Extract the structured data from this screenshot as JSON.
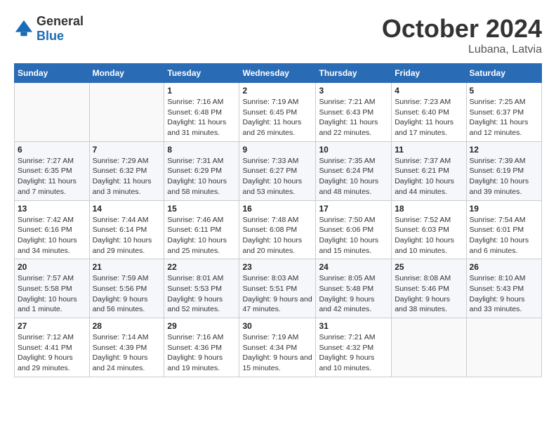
{
  "header": {
    "logo": {
      "general": "General",
      "blue": "Blue"
    },
    "title": "October 2024",
    "location": "Lubana, Latvia"
  },
  "calendar": {
    "days_of_week": [
      "Sunday",
      "Monday",
      "Tuesday",
      "Wednesday",
      "Thursday",
      "Friday",
      "Saturday"
    ],
    "weeks": [
      [
        {
          "day": "",
          "info": ""
        },
        {
          "day": "",
          "info": ""
        },
        {
          "day": "1",
          "info": "Sunrise: 7:16 AM\nSunset: 6:48 PM\nDaylight: 11 hours and 31 minutes."
        },
        {
          "day": "2",
          "info": "Sunrise: 7:19 AM\nSunset: 6:45 PM\nDaylight: 11 hours and 26 minutes."
        },
        {
          "day": "3",
          "info": "Sunrise: 7:21 AM\nSunset: 6:43 PM\nDaylight: 11 hours and 22 minutes."
        },
        {
          "day": "4",
          "info": "Sunrise: 7:23 AM\nSunset: 6:40 PM\nDaylight: 11 hours and 17 minutes."
        },
        {
          "day": "5",
          "info": "Sunrise: 7:25 AM\nSunset: 6:37 PM\nDaylight: 11 hours and 12 minutes."
        }
      ],
      [
        {
          "day": "6",
          "info": "Sunrise: 7:27 AM\nSunset: 6:35 PM\nDaylight: 11 hours and 7 minutes."
        },
        {
          "day": "7",
          "info": "Sunrise: 7:29 AM\nSunset: 6:32 PM\nDaylight: 11 hours and 3 minutes."
        },
        {
          "day": "8",
          "info": "Sunrise: 7:31 AM\nSunset: 6:29 PM\nDaylight: 10 hours and 58 minutes."
        },
        {
          "day": "9",
          "info": "Sunrise: 7:33 AM\nSunset: 6:27 PM\nDaylight: 10 hours and 53 minutes."
        },
        {
          "day": "10",
          "info": "Sunrise: 7:35 AM\nSunset: 6:24 PM\nDaylight: 10 hours and 48 minutes."
        },
        {
          "day": "11",
          "info": "Sunrise: 7:37 AM\nSunset: 6:21 PM\nDaylight: 10 hours and 44 minutes."
        },
        {
          "day": "12",
          "info": "Sunrise: 7:39 AM\nSunset: 6:19 PM\nDaylight: 10 hours and 39 minutes."
        }
      ],
      [
        {
          "day": "13",
          "info": "Sunrise: 7:42 AM\nSunset: 6:16 PM\nDaylight: 10 hours and 34 minutes."
        },
        {
          "day": "14",
          "info": "Sunrise: 7:44 AM\nSunset: 6:14 PM\nDaylight: 10 hours and 29 minutes."
        },
        {
          "day": "15",
          "info": "Sunrise: 7:46 AM\nSunset: 6:11 PM\nDaylight: 10 hours and 25 minutes."
        },
        {
          "day": "16",
          "info": "Sunrise: 7:48 AM\nSunset: 6:08 PM\nDaylight: 10 hours and 20 minutes."
        },
        {
          "day": "17",
          "info": "Sunrise: 7:50 AM\nSunset: 6:06 PM\nDaylight: 10 hours and 15 minutes."
        },
        {
          "day": "18",
          "info": "Sunrise: 7:52 AM\nSunset: 6:03 PM\nDaylight: 10 hours and 10 minutes."
        },
        {
          "day": "19",
          "info": "Sunrise: 7:54 AM\nSunset: 6:01 PM\nDaylight: 10 hours and 6 minutes."
        }
      ],
      [
        {
          "day": "20",
          "info": "Sunrise: 7:57 AM\nSunset: 5:58 PM\nDaylight: 10 hours and 1 minute."
        },
        {
          "day": "21",
          "info": "Sunrise: 7:59 AM\nSunset: 5:56 PM\nDaylight: 9 hours and 56 minutes."
        },
        {
          "day": "22",
          "info": "Sunrise: 8:01 AM\nSunset: 5:53 PM\nDaylight: 9 hours and 52 minutes."
        },
        {
          "day": "23",
          "info": "Sunrise: 8:03 AM\nSunset: 5:51 PM\nDaylight: 9 hours and 47 minutes."
        },
        {
          "day": "24",
          "info": "Sunrise: 8:05 AM\nSunset: 5:48 PM\nDaylight: 9 hours and 42 minutes."
        },
        {
          "day": "25",
          "info": "Sunrise: 8:08 AM\nSunset: 5:46 PM\nDaylight: 9 hours and 38 minutes."
        },
        {
          "day": "26",
          "info": "Sunrise: 8:10 AM\nSunset: 5:43 PM\nDaylight: 9 hours and 33 minutes."
        }
      ],
      [
        {
          "day": "27",
          "info": "Sunrise: 7:12 AM\nSunset: 4:41 PM\nDaylight: 9 hours and 29 minutes."
        },
        {
          "day": "28",
          "info": "Sunrise: 7:14 AM\nSunset: 4:39 PM\nDaylight: 9 hours and 24 minutes."
        },
        {
          "day": "29",
          "info": "Sunrise: 7:16 AM\nSunset: 4:36 PM\nDaylight: 9 hours and 19 minutes."
        },
        {
          "day": "30",
          "info": "Sunrise: 7:19 AM\nSunset: 4:34 PM\nDaylight: 9 hours and 15 minutes."
        },
        {
          "day": "31",
          "info": "Sunrise: 7:21 AM\nSunset: 4:32 PM\nDaylight: 9 hours and 10 minutes."
        },
        {
          "day": "",
          "info": ""
        },
        {
          "day": "",
          "info": ""
        }
      ]
    ]
  }
}
